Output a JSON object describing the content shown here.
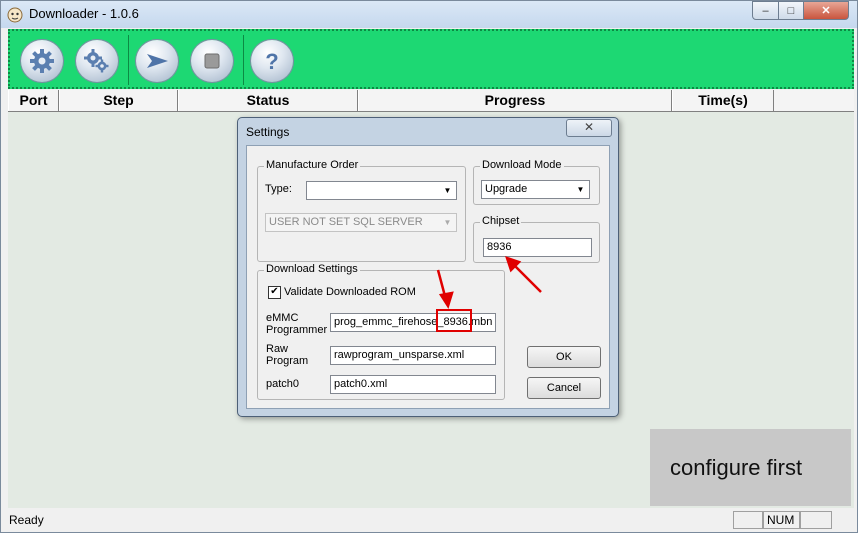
{
  "window": {
    "title": "Downloader - 1.0.6",
    "min_glyph": "–",
    "max_glyph": "□",
    "close_glyph": "✕"
  },
  "toolbar": {
    "buttons": [
      "gear-icon",
      "gears-icon",
      "start-arrow-icon",
      "stop-icon",
      "help-icon"
    ]
  },
  "table": {
    "columns": [
      "Port",
      "Step",
      "Status",
      "Progress",
      "Time(s)"
    ]
  },
  "overlay": {
    "text": "configure first"
  },
  "statusbar": {
    "ready": "Ready",
    "num": "NUM"
  },
  "dialog": {
    "title": "Settings",
    "close_glyph": "✕",
    "manufacture_order": {
      "legend": "Manufacture Order",
      "type_label": "Type:",
      "type_value": "",
      "server_value": "USER NOT SET SQL SERVER"
    },
    "download_mode": {
      "legend": "Download Mode",
      "value": "Upgrade"
    },
    "chipset": {
      "legend": "Chipset",
      "value": "8936"
    },
    "download_settings": {
      "legend": "Download Settings",
      "validate_label": "Validate Downloaded ROM",
      "validate_checked": true,
      "emmc_label_1": "eMMC",
      "emmc_label_2": "Programmer",
      "emmc_value": "prog_emmc_firehose_8936.mbn",
      "raw_label_1": "Raw",
      "raw_label_2": "Program",
      "raw_value": "rawprogram_unsparse.xml",
      "patch_label": "patch0",
      "patch_value": "patch0.xml"
    },
    "ok": "OK",
    "cancel": "Cancel"
  },
  "colors": {
    "toolbar": "#1dd873",
    "highlight": "#e00000"
  }
}
